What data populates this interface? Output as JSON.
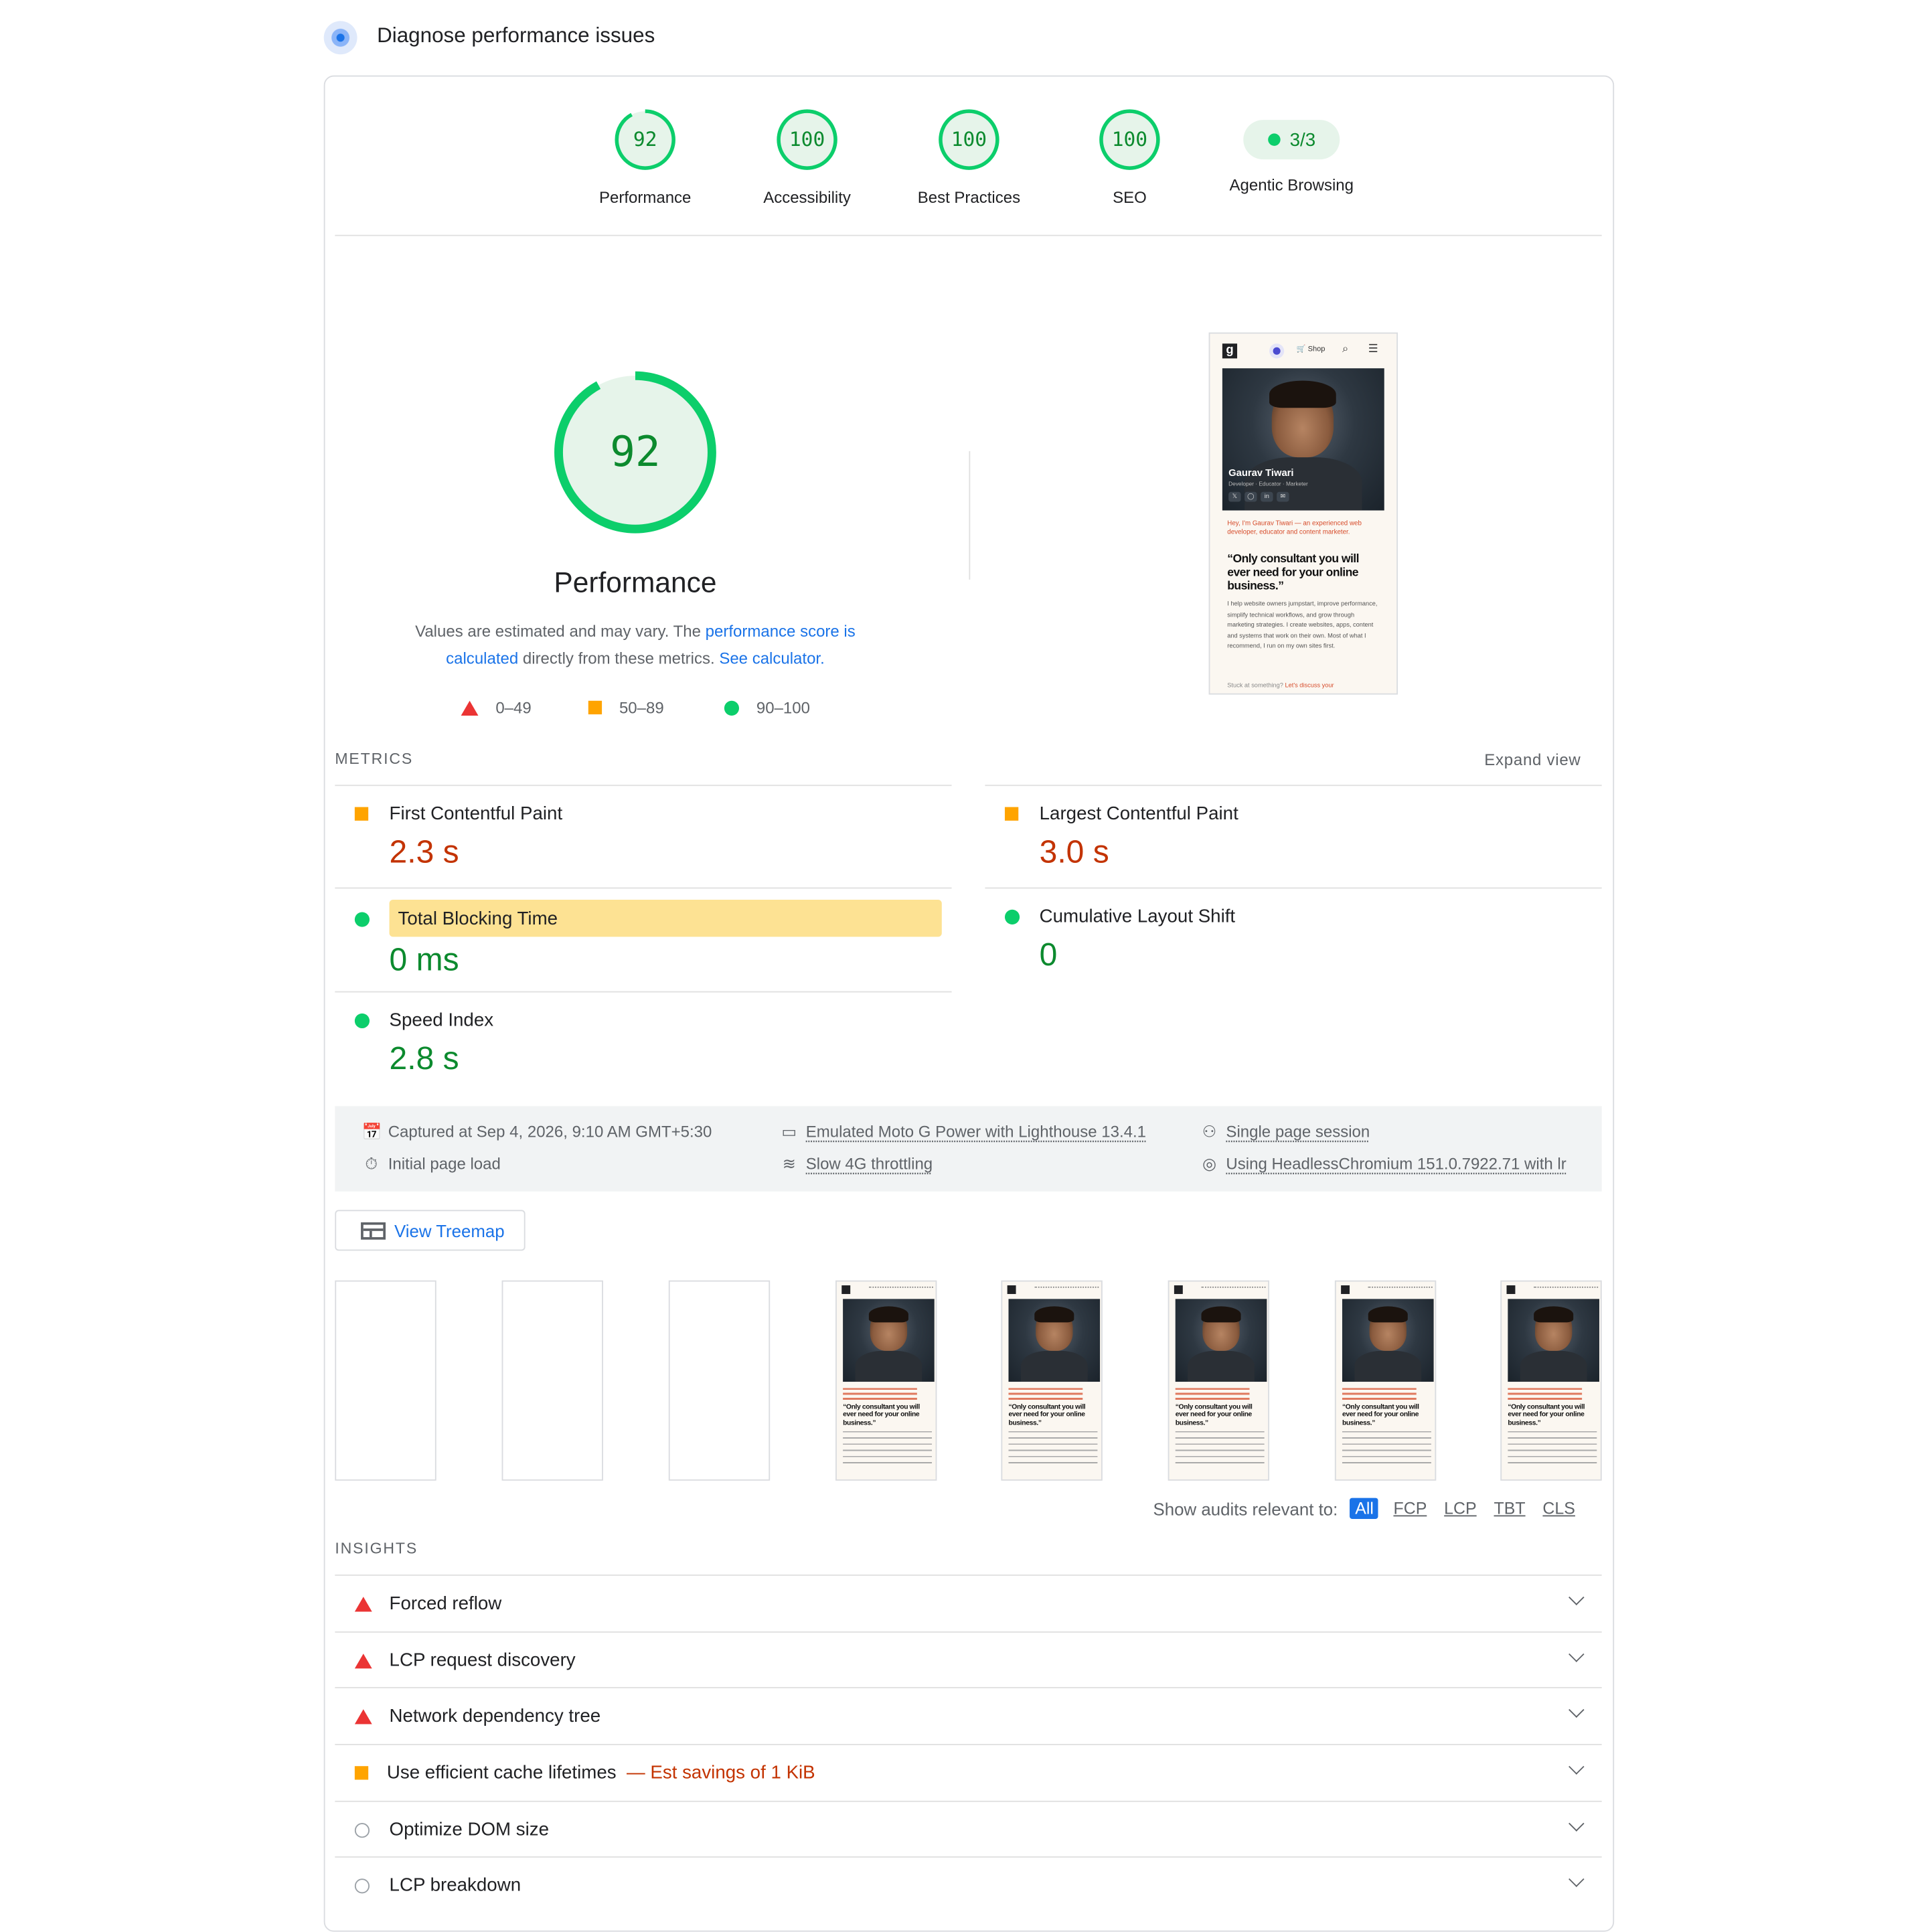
{
  "header": {
    "title": "Diagnose performance issues"
  },
  "colors": {
    "pass": "#0cce6b",
    "average": "#ffa400",
    "fail": "#eb3434",
    "link": "#1a73e8",
    "highlight": "#fde293"
  },
  "gauges": [
    {
      "score": "92",
      "label": "Performance",
      "fraction": 0.92
    },
    {
      "score": "100",
      "label": "Accessibility",
      "fraction": 1.0
    },
    {
      "score": "100",
      "label": "Best Practices",
      "fraction": 1.0
    },
    {
      "score": "100",
      "label": "SEO",
      "fraction": 1.0
    }
  ],
  "agentic": {
    "value": "3/3",
    "label": "Agentic Browsing"
  },
  "summary": {
    "score": "92",
    "fraction": 0.92,
    "title": "Performance",
    "desc_pre": "Values are estimated and may vary. The ",
    "desc_link": "performance score is calculated",
    "desc_mid": " directly from these metrics. ",
    "desc_link2": "See calculator.",
    "legend": [
      "0–49",
      "50–89",
      "90–100"
    ]
  },
  "screenshot": {
    "shop": "Shop",
    "name": "Gaurav Tiwari",
    "subtitle": "Developer · Educator · Marketer",
    "intro": "Hey, I'm Gaurav Tiwari — an experienced web developer, educator and content marketer.",
    "quote": "“Only consultant you will ever need for your online business.”",
    "para": "I help website owners jumpstart, improve performance, simplify technical workflows, and grow through marketing strategies. I create websites, apps, content and systems that work on their own. Most of what I recommend, I run on my own sites first.",
    "foot_pre": "Stuck at something? ",
    "foot_link": "Let's discuss your"
  },
  "metrics": {
    "title": "METRICS",
    "expand": "Expand view",
    "items": [
      {
        "label": "First Contentful Paint",
        "value": "2.3 s",
        "rating": "average"
      },
      {
        "label": "Largest Contentful Paint",
        "value": "3.0 s",
        "rating": "average"
      },
      {
        "label": "Total Blocking Time",
        "value": "0 ms",
        "rating": "pass"
      },
      {
        "label": "Cumulative Layout Shift",
        "value": "0",
        "rating": "pass"
      },
      {
        "label": "Speed Index",
        "value": "2.8 s",
        "rating": "pass"
      }
    ]
  },
  "runtime": {
    "captured": "Captured at Sep 4, 2026, 9:10 AM GMT+5:30",
    "initial": "Initial page load",
    "device": "Emulated Moto G Power with Lighthouse 13.4.1",
    "throttling": "Slow 4G throttling",
    "session": "Single page session",
    "browser": "Using HeadlessChromium 151.0.7922.71 with lr"
  },
  "treemap": {
    "label": "View Treemap"
  },
  "filmstrip_quote": "“Only consultant you will ever need for your online business.”",
  "filters": {
    "label": "Show audits relevant to:",
    "options": [
      "All",
      "FCP",
      "LCP",
      "TBT",
      "CLS"
    ]
  },
  "insights": {
    "title": "INSIGHTS",
    "items": [
      {
        "label": "Forced reflow",
        "rating": "fail",
        "savings": ""
      },
      {
        "label": "LCP request discovery",
        "rating": "fail",
        "savings": ""
      },
      {
        "label": "Network dependency tree",
        "rating": "fail",
        "savings": ""
      },
      {
        "label": "Use efficient cache lifetimes",
        "rating": "average",
        "savings": "— Est savings of 1 KiB"
      },
      {
        "label": "Optimize DOM size",
        "rating": "info",
        "savings": ""
      },
      {
        "label": "LCP breakdown",
        "rating": "info",
        "savings": ""
      }
    ]
  }
}
